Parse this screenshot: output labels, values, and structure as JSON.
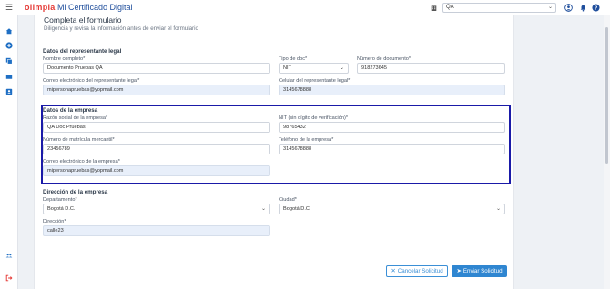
{
  "topbar": {
    "logo": "olimpia",
    "app_title": "Mi Certificado Digital",
    "org_value": "QA"
  },
  "form": {
    "title": "Completa el formulario",
    "subtitle": "Diligencia y revisa la información antes de enviar el formulario"
  },
  "legal_rep": {
    "section": "Datos del representante legal",
    "name_label": "Nombre completo*",
    "name_value": "Documento Pruebas QA",
    "doc_type_label": "Tipo de doc*",
    "doc_type_value": "NIT",
    "doc_number_label": "Número de documento*",
    "doc_number_value": "918273645",
    "email_label": "Correo electrónico del representante legal*",
    "email_value": "mipersonapruebas@yopmail.com",
    "phone_label": "Celular del representante legal*",
    "phone_value": "3145678888"
  },
  "company": {
    "section": "Datos de la empresa",
    "name_label": "Razón social de la empresa*",
    "name_value": "QA Doc Pruebas",
    "nit_label": "NIT (sin dígito de verificación)*",
    "nit_value": "98765432",
    "reg_label": "Número de matrícula mercantil*",
    "reg_value": "23456789",
    "phone_label": "Teléfono de la empresa*",
    "phone_value": "3145678888",
    "email_label": "Correo electrónico de la empresa*",
    "email_value": "mipersonapruebas@yopmail.com"
  },
  "address": {
    "section": "Dirección de la empresa",
    "dept_label": "Departamento*",
    "dept_value": "Bogotá D.C.",
    "city_label": "Ciudad*",
    "city_value": "Bogotá D.C.",
    "addr_label": "Dirección*",
    "addr_value": "calle23"
  },
  "actions": {
    "cancel_label": "Cancelar Solicitud",
    "send_label": "Enviar Solicitud"
  },
  "colors": {
    "accent": "#2f86d1",
    "highlight": "#1a1aa8",
    "brand_red": "#e53935"
  }
}
